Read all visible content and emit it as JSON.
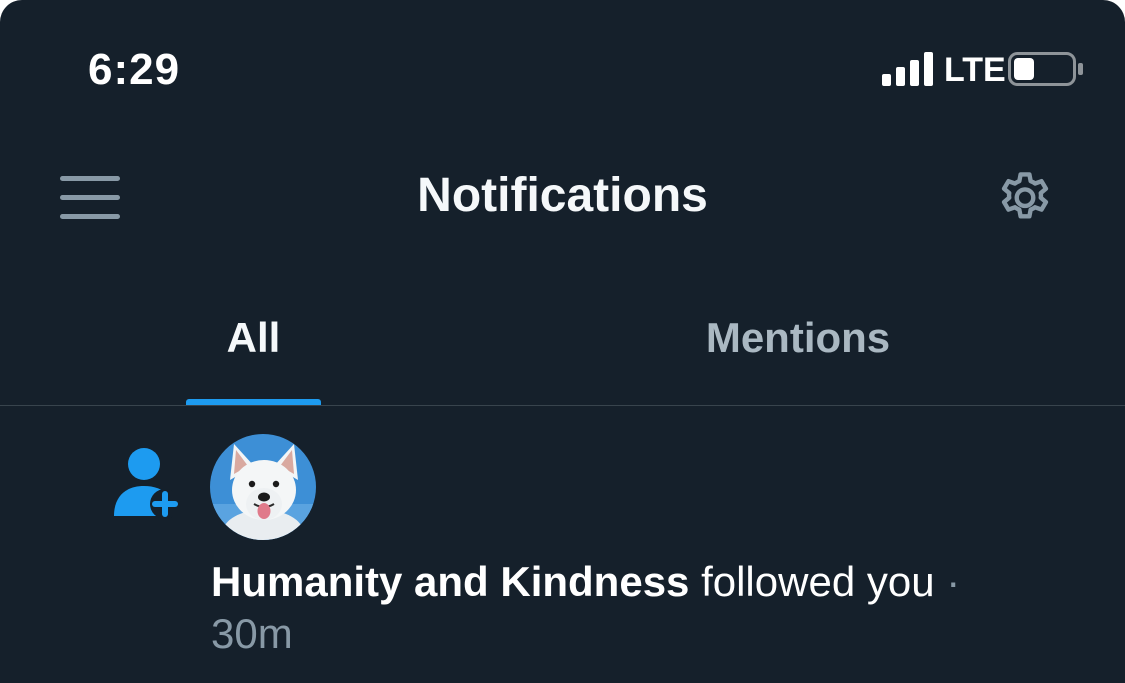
{
  "status_bar": {
    "time": "6:29",
    "network": "LTE",
    "battery_level": 0.35
  },
  "header": {
    "title": "Notifications",
    "menu_icon": "hamburger-menu-icon",
    "settings_icon": "gear-icon"
  },
  "tabs": [
    {
      "label": "All",
      "active": true
    },
    {
      "label": "Mentions",
      "active": false
    }
  ],
  "notifications": [
    {
      "type_icon": "follow-person-plus-icon",
      "avatar": "white-dog-avatar",
      "actor": "Humanity and Kindness",
      "action": "followed you",
      "separator": "·",
      "time_ago": "30m"
    }
  ],
  "colors": {
    "background": "#15202b",
    "accent": "#1d9bf0",
    "muted_text": "#8899a6",
    "inactive_tab": "#aab8c2",
    "divider": "#38444d"
  }
}
